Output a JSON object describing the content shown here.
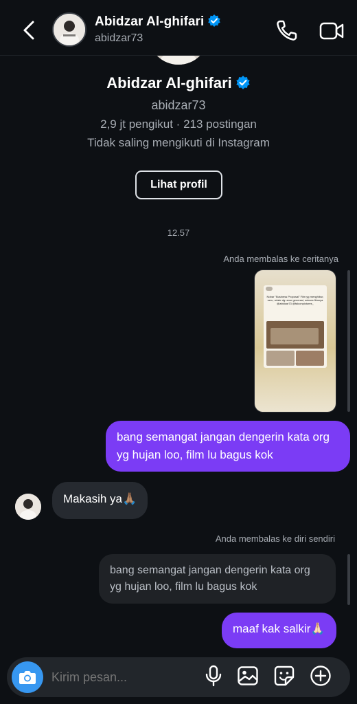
{
  "header": {
    "name": "Abidzar Al-ghifari",
    "username": "abidzar73"
  },
  "profile": {
    "name": "Abidzar Al-ghifari",
    "username": "abidzar73",
    "stats": "2,9 jt pengikut · 213 postingan",
    "follow_status": "Tidak saling mengikuti di Instagram",
    "view_profile_label": "Lihat profil"
  },
  "chat": {
    "timestamp": "12.57",
    "story_reply_note": "Anda membalas ke ceritanya",
    "story_text": "Nobar \"Business Proposal\" Film yg menghibur, seru, relate dg umur generasi, sukses filmnya @abidzar73 @falconpictures_",
    "messages": [
      {
        "sender": "me",
        "text": "bang semangat jangan dengerin kata org yg hujan loo, film lu bagus kok"
      },
      {
        "sender": "them",
        "text": "Makasih ya🙏🏽"
      },
      {
        "sender": "me",
        "text": "maaf kak salkir🙏🏻"
      }
    ],
    "self_reply_note": "Anda membalas ke diri sendiri",
    "quoted_text": "bang semangat jangan dengerin kata org yg hujan loo, film lu bagus kok"
  },
  "composer": {
    "placeholder": "Kirim pesan..."
  },
  "colors": {
    "background": "#0d1014",
    "my_bubble": "#7b3cf5",
    "their_bubble": "#262a30",
    "camera_button": "#3797f0",
    "verified_badge": "#0095f6"
  },
  "icons": [
    "back-arrow-icon",
    "verified-badge-icon",
    "phone-icon",
    "video-camera-icon",
    "camera-icon",
    "microphone-icon",
    "image-icon",
    "sticker-icon",
    "plus-icon"
  ]
}
